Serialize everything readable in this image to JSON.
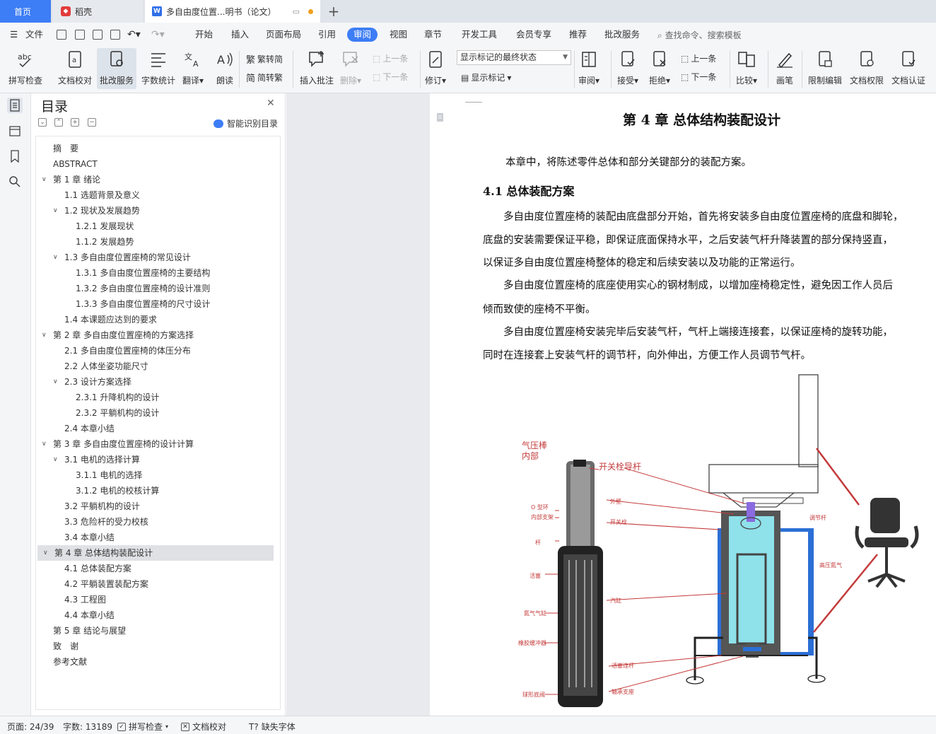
{
  "tabs": {
    "home": "首页",
    "docer": "稻壳",
    "doc": "多自由度位置...明书（论文）"
  },
  "menu": {
    "file": "文件",
    "items": [
      "开始",
      "插入",
      "页面布局",
      "引用",
      "审阅",
      "视图",
      "章节",
      "开发工具",
      "会员专享",
      "推荐",
      "批改服务"
    ],
    "active": "审阅",
    "search": "查找命令、搜索模板"
  },
  "ribbon": {
    "spellcheck": "拼写检查",
    "doccheck": "文档校对",
    "correction": "批改服务",
    "wordcount": "字数统计",
    "translate": "翻译",
    "read": "朗读",
    "to_traditional": "繁转简",
    "to_simplified": "简转繁",
    "insert_comment": "插入批注",
    "delete": "删除",
    "prev": "上一条",
    "next": "下一条",
    "revise": "修订",
    "markup_state": "显示标记的最终状态",
    "show_markup": "显示标记",
    "review": "审阅",
    "accept": "接受",
    "reject": "拒绝",
    "prev2": "上一条",
    "next2": "下一条",
    "compare": "比较",
    "pen": "画笔",
    "restrict_edit": "限制编辑",
    "doc_permission": "文档权限",
    "doc_cert": "文档认证"
  },
  "toc": {
    "title": "目录",
    "smart": "智能识别目录",
    "items": [
      {
        "text": "摘　要",
        "level": 0,
        "chev": ""
      },
      {
        "text": "ABSTRACT",
        "level": 0,
        "chev": ""
      },
      {
        "text": "第 1 章  绪论",
        "level": 0,
        "chev": "v"
      },
      {
        "text": "1.1 选题背景及意义",
        "level": 1,
        "chev": ""
      },
      {
        "text": "1.2  现状及发展趋势",
        "level": 1,
        "chev": "v"
      },
      {
        "text": "1.2.1  发展现状",
        "level": 2,
        "chev": ""
      },
      {
        "text": "1.1.2  发展趋势",
        "level": 2,
        "chev": ""
      },
      {
        "text": "1.3 多自由度位置座椅的常见设计",
        "level": 1,
        "chev": "v"
      },
      {
        "text": "1.3.1  多自由度位置座椅的主要结构",
        "level": 2,
        "chev": ""
      },
      {
        "text": "1.3.2  多自由度位置座椅的设计准则",
        "level": 2,
        "chev": ""
      },
      {
        "text": "1.3.3  多自由度位置座椅的尺寸设计",
        "level": 2,
        "chev": ""
      },
      {
        "text": "1.4  本课题应达到的要求",
        "level": 1,
        "chev": ""
      },
      {
        "text": "第 2 章  多自由度位置座椅的方案选择",
        "level": 0,
        "chev": "v"
      },
      {
        "text": "2.1  多自由度位置座椅的体压分布",
        "level": 1,
        "chev": ""
      },
      {
        "text": "2.2 人体坐姿功能尺寸",
        "level": 1,
        "chev": ""
      },
      {
        "text": "2.3  设计方案选择",
        "level": 1,
        "chev": "v"
      },
      {
        "text": "2.3.1  升降机构的设计",
        "level": 2,
        "chev": ""
      },
      {
        "text": "2.3.2  平躺机构的设计",
        "level": 2,
        "chev": ""
      },
      {
        "text": "2.4  本章小结",
        "level": 1,
        "chev": ""
      },
      {
        "text": "第 3 章  多自由度位置座椅的设计计算",
        "level": 0,
        "chev": "v"
      },
      {
        "text": "3.1 电机的选择计算",
        "level": 1,
        "chev": "v"
      },
      {
        "text": "3.1.1 电机的选择",
        "level": 2,
        "chev": ""
      },
      {
        "text": "3.1.2 电机的校核计算",
        "level": 2,
        "chev": ""
      },
      {
        "text": "3.2 平躺机构的设计",
        "level": 1,
        "chev": ""
      },
      {
        "text": "3.3 危险杆的受力校核",
        "level": 1,
        "chev": ""
      },
      {
        "text": "3.4 本章小结",
        "level": 1,
        "chev": ""
      },
      {
        "text": "第 4 章  总体结构装配设计",
        "level": 0,
        "chev": "v",
        "selected": true
      },
      {
        "text": "4.1 总体装配方案",
        "level": 1,
        "chev": ""
      },
      {
        "text": "4.2 平躺装置装配方案",
        "level": 1,
        "chev": ""
      },
      {
        "text": "4.3  工程图",
        "level": 1,
        "chev": ""
      },
      {
        "text": "4.4 本章小结",
        "level": 1,
        "chev": ""
      },
      {
        "text": "第 5 章  结论与展望",
        "level": 0,
        "chev": ""
      },
      {
        "text": "致　谢",
        "level": 0,
        "chev": ""
      },
      {
        "text": "参考文献",
        "level": 0,
        "chev": ""
      }
    ]
  },
  "doc": {
    "chapter_title": "第 4 章  总体结构装配设计",
    "intro": "本章中，将陈述零件总体和部分关键部分的装配方案。",
    "section": "4.1 总体装配方案",
    "lines": [
      "　　多自由度位置座椅的装配由底盘部分开始，首先将安装多自由度位置座椅的底盘和脚轮，",
      "底盘的安装需要保证平稳，即保证底面保持水平，之后安装气杆升降装置的部分保持竖直，",
      "以保证多自由度位置座椅整体的稳定和后续安装以及功能的正常运行。",
      "　　多自由度位置座椅的底座使用实心的钢材制成，以增加座椅稳定性，避免因工作人员后",
      "倾而致使的座椅不平衡。",
      "　　多自由度位置座椅安装完毕后安装气杆，气杆上端接连接套，以保证座椅的旋转功能，",
      "同时在连接套上安装气杆的调节杆，向外伸出，方便工作人员调节气杆。"
    ],
    "figure_labels": {
      "title1": "气压棒",
      "title2": "内部",
      "switch_rod": "开关栓导杆",
      "o_ring": "O 型环",
      "inner_support": "内部支架",
      "rod": "杆",
      "piston": "活塞",
      "gas_chamber": "氮气气缸",
      "rubber_buffer": "橡胶缓冲器",
      "ball_valve": "球形底阀",
      "outer_wall": "外壁",
      "switch": "开关栓",
      "cylinder": "汽缸",
      "piston_rod": "活塞连杆",
      "bearing": "轴承支座",
      "adjust_rod": "调节杆",
      "high_pressure": "高压氮气"
    }
  },
  "status": {
    "page": "页面: 24/39",
    "words": "字数: 13189",
    "spellcheck": "拼写检查",
    "doccheck": "文档校对",
    "missing_font": "缺失字体"
  }
}
